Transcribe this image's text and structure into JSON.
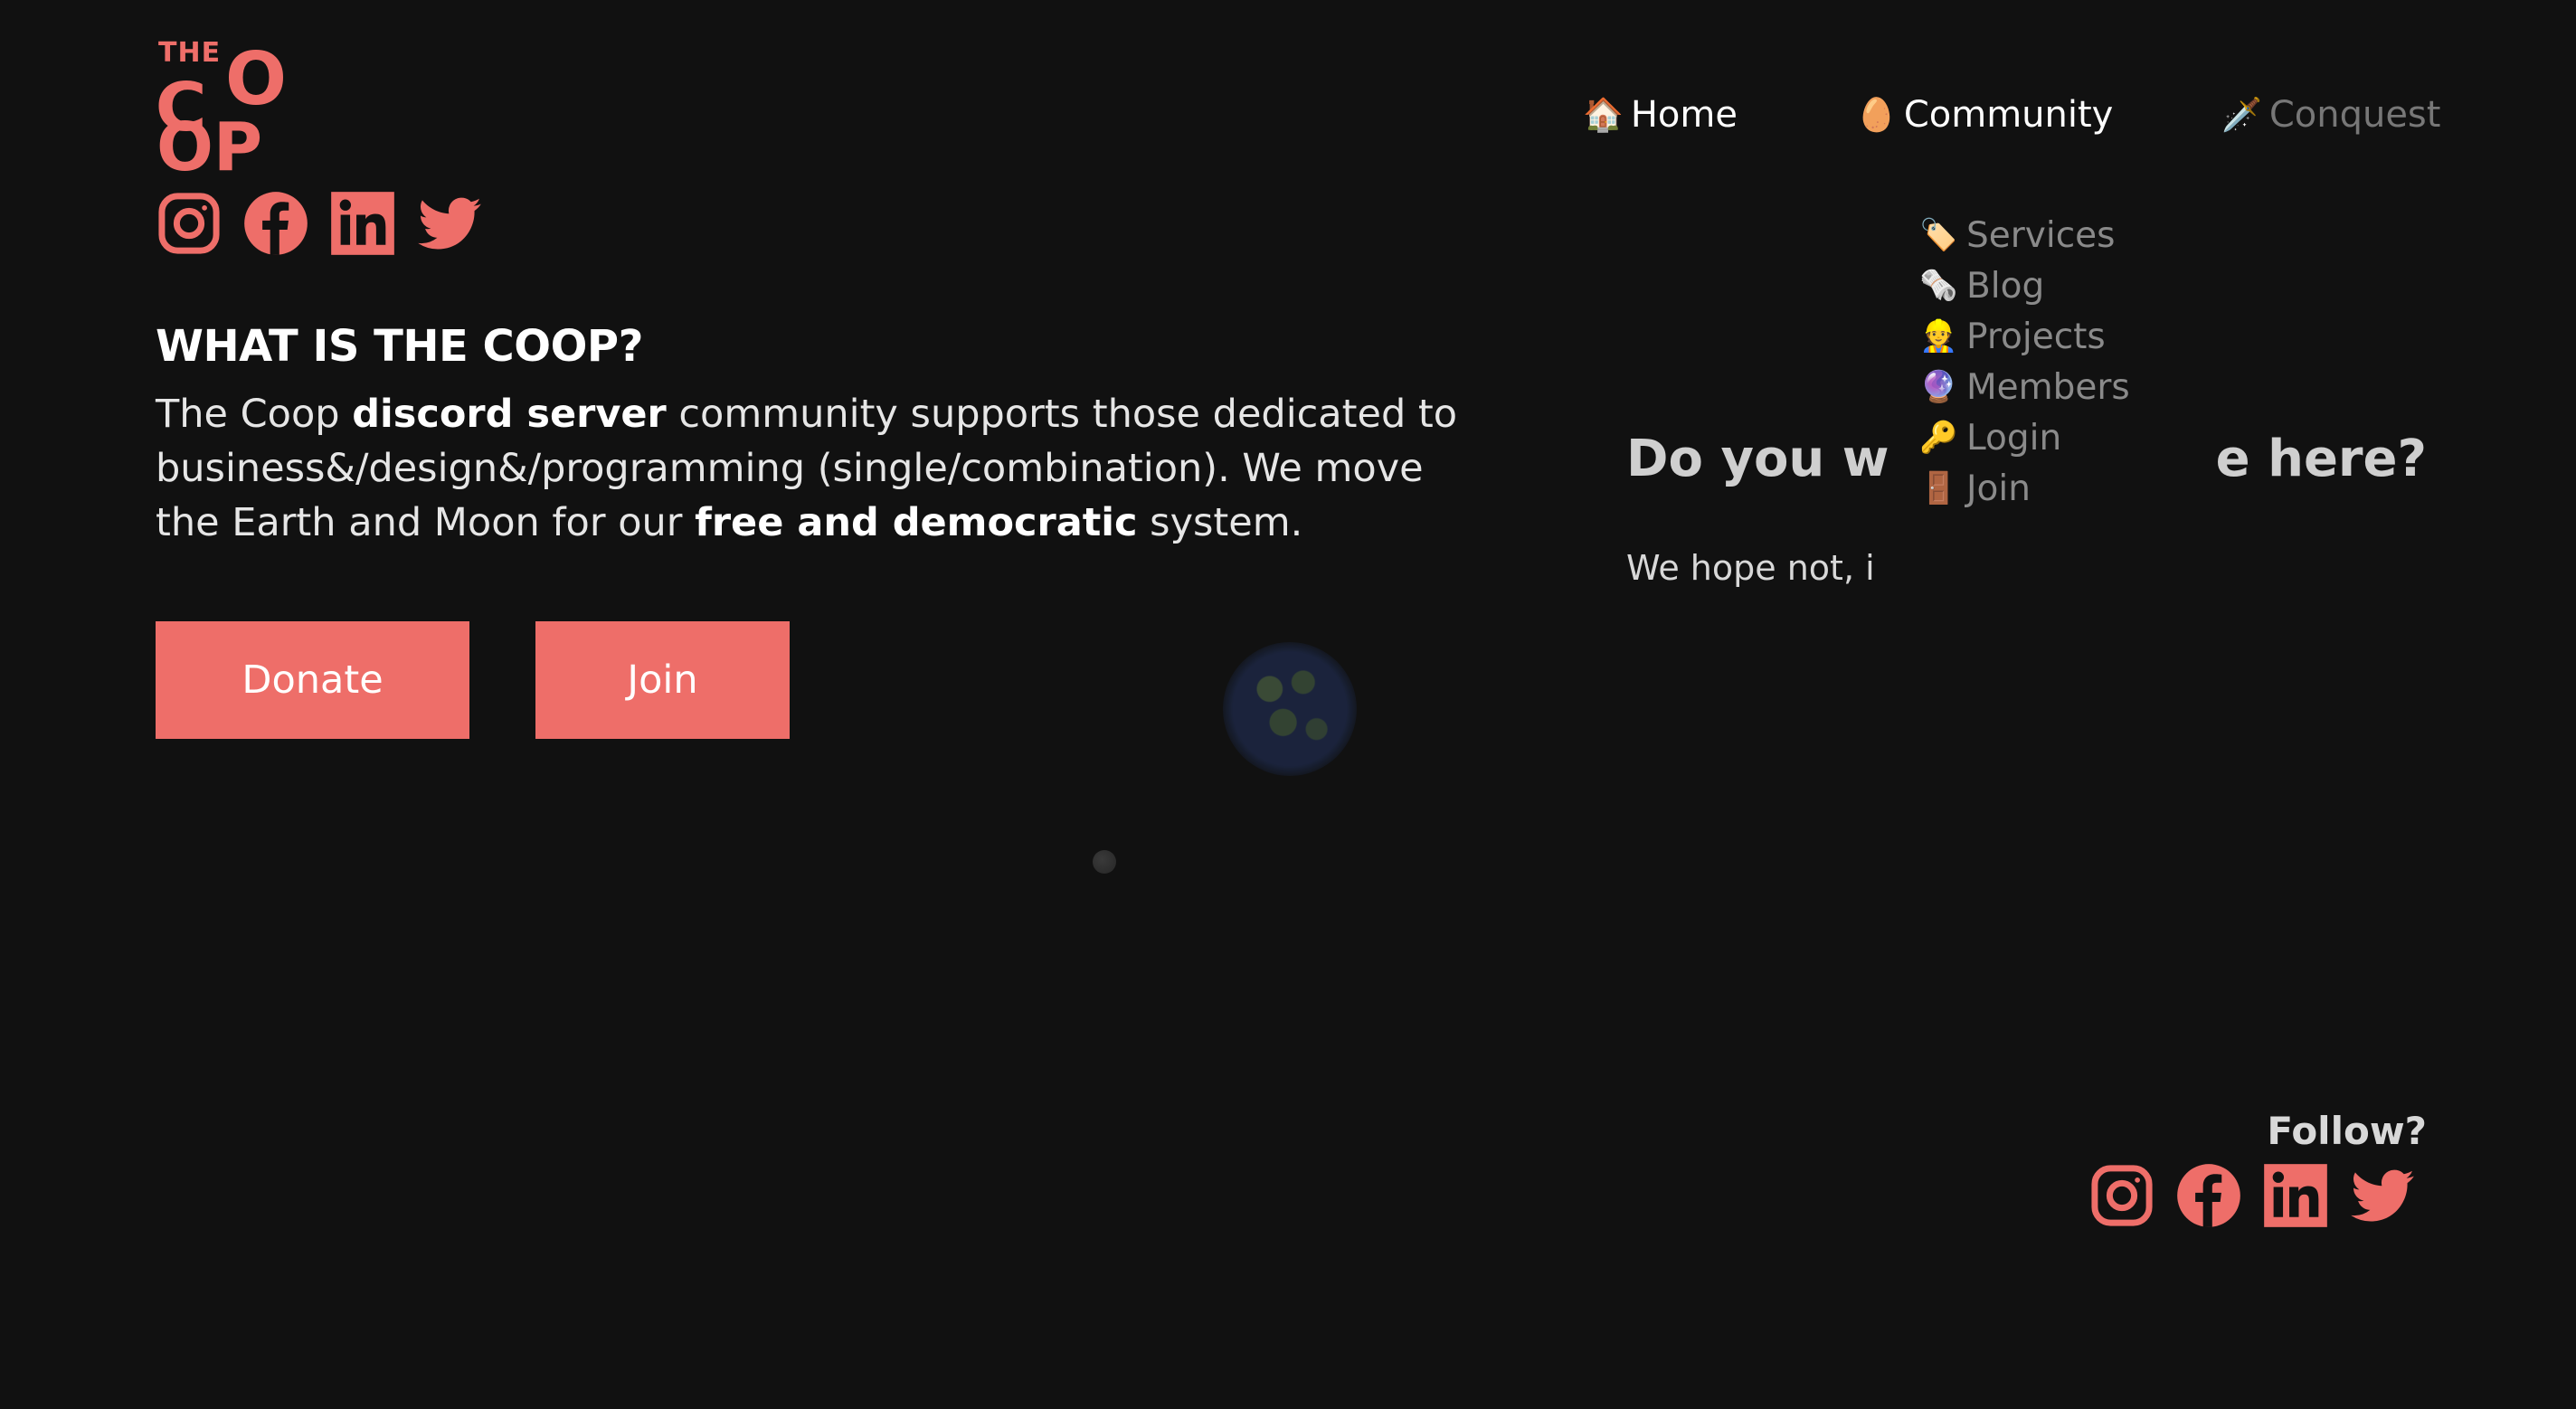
{
  "brand": {
    "logo_the": "THE",
    "logo_c": "C",
    "logo_o": "O",
    "logo_op": "OP",
    "accent_color": "#ee6e69"
  },
  "social_icons": [
    "instagram-icon",
    "facebook-icon",
    "linkedin-icon",
    "twitter-icon"
  ],
  "nav": {
    "home": {
      "icon": "🏠",
      "label": "Home"
    },
    "community": {
      "icon": "🥚",
      "label": "Community"
    },
    "conquest": {
      "icon": "🗡️",
      "label": "Conquest"
    }
  },
  "dropdown": [
    {
      "icon": "🏷️",
      "label": "Services"
    },
    {
      "icon": "🗞️",
      "label": "Blog"
    },
    {
      "icon": "👷",
      "label": "Projects"
    },
    {
      "icon": "🔮",
      "label": "Members"
    },
    {
      "icon": "🔑",
      "label": "Login"
    },
    {
      "icon": "🚪",
      "label": "Join"
    }
  ],
  "hero": {
    "heading": "WHAT IS THE COOP?",
    "intro_1": "The Coop ",
    "intro_bold_1": "discord server",
    "intro_2": " community supports those dedicated to business&/design&/programming (single/combination). We move the Earth and Moon for our ",
    "intro_bold_2": "free and democratic",
    "intro_3": " system.",
    "donate_label": "Donate",
    "join_label": "Join"
  },
  "question": {
    "heading_left": "Do you w",
    "heading_right": "e here?",
    "text": "We hope not, i"
  },
  "footer": {
    "follow_label": "Follow?"
  }
}
